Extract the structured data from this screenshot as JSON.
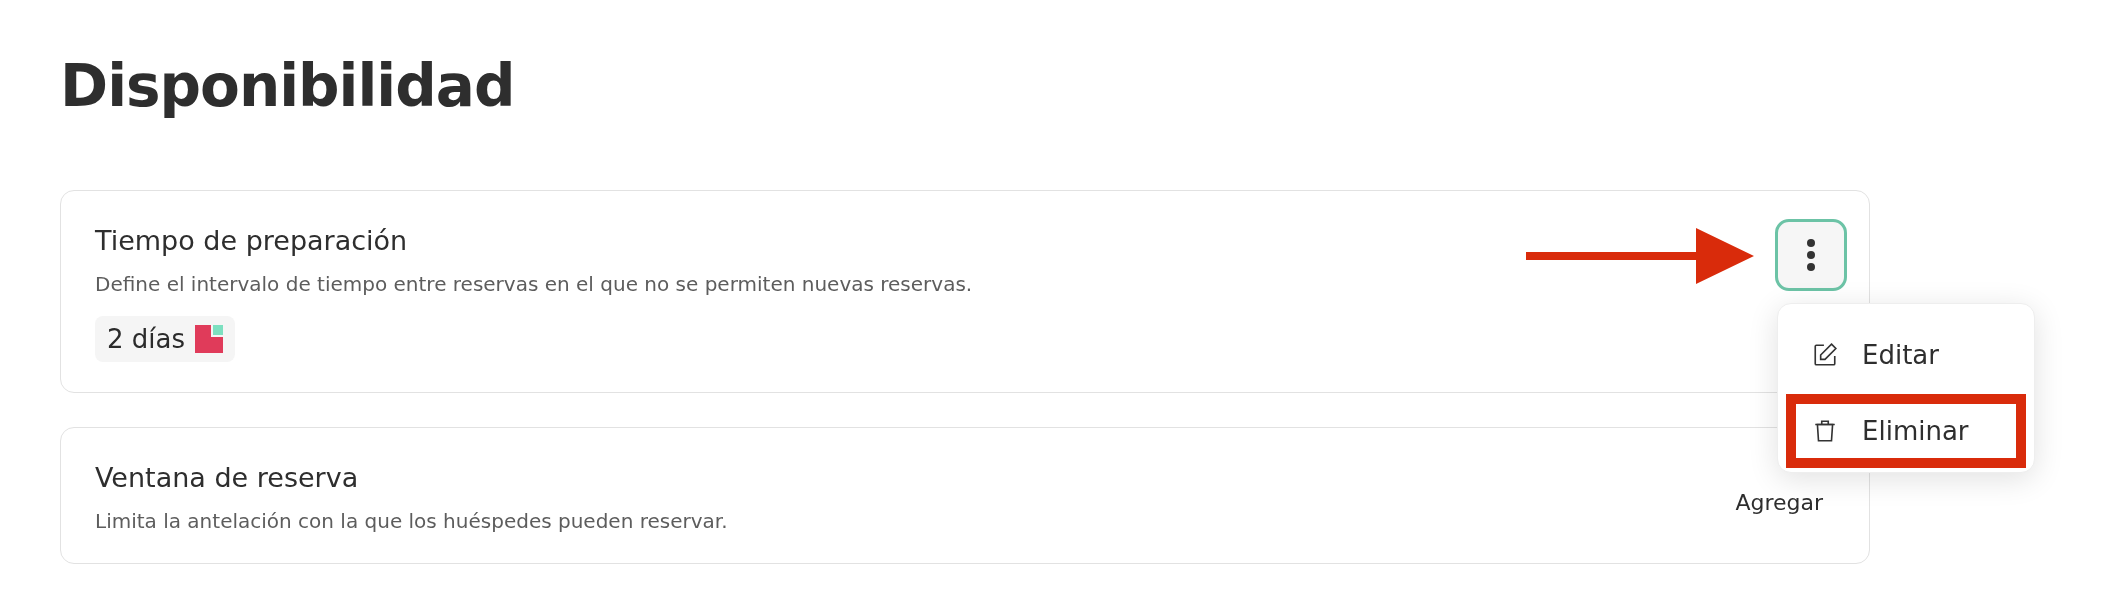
{
  "heading": "Disponibilidad",
  "settings": [
    {
      "kind": "value",
      "title": "Tiempo de preparación",
      "description": "Define el intervalo de tiempo entre reservas en el que no se permiten nuevas reservas.",
      "value": "2 días",
      "menu_button": {
        "focused": true
      },
      "menu": {
        "open": true,
        "items": [
          {
            "kind": "edit",
            "label": "Editar",
            "highlighted": false
          },
          {
            "kind": "delete",
            "label": "Eliminar",
            "highlighted": true
          }
        ]
      },
      "pointer_arrow": true
    },
    {
      "kind": "add",
      "title": "Ventana de reserva",
      "description": "Limita la antelación con la que los huéspedes pueden reservar.",
      "action": "Agregar"
    }
  ]
}
